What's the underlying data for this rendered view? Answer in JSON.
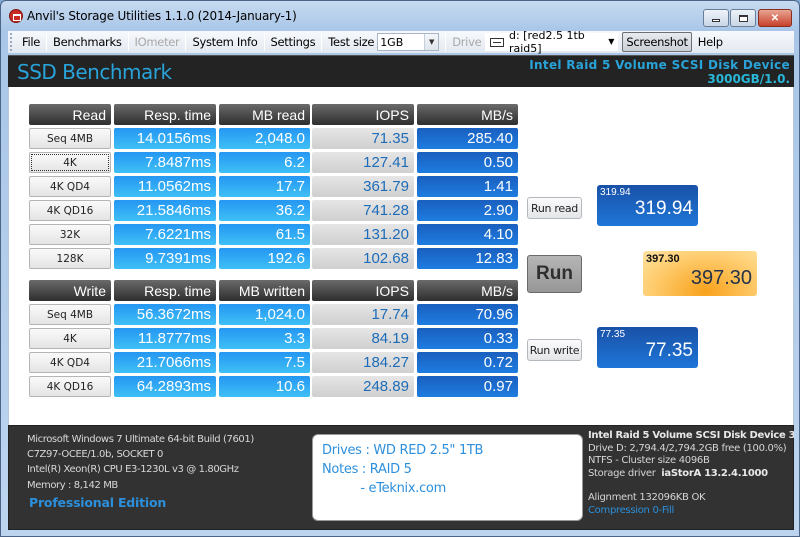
{
  "window": {
    "title": "Anvil's Storage Utilities 1.1.0 (2014-January-1)",
    "controls": [
      "minimize",
      "maximize",
      "close"
    ]
  },
  "toolbar": {
    "items": [
      "File",
      "Benchmarks",
      "IOmeter",
      "System Info",
      "Settings"
    ],
    "test_size_label": "Test size",
    "test_size_value": "1GB",
    "drive_label": "Drive",
    "drive_value": "d: [red2.5 1tb raid5]",
    "screenshot_label": "Screenshot",
    "help_label": "Help"
  },
  "header": {
    "title": "SSD Benchmark",
    "device": "Intel Raid 5 Volume SCSI Disk Device",
    "size": "3000GB/1.0."
  },
  "read": {
    "headers": [
      "Read",
      "Resp. time",
      "MB read",
      "IOPS",
      "MB/s"
    ],
    "rows": [
      {
        "label": "Seq 4MB",
        "resp": "14.0156ms",
        "mb": "2,048.0",
        "iops": "71.35",
        "mbs": "285.40"
      },
      {
        "label": "4K",
        "resp": "7.8487ms",
        "mb": "6.2",
        "iops": "127.41",
        "mbs": "0.50"
      },
      {
        "label": "4K QD4",
        "resp": "11.0562ms",
        "mb": "17.7",
        "iops": "361.79",
        "mbs": "1.41"
      },
      {
        "label": "4K QD16",
        "resp": "21.5846ms",
        "mb": "36.2",
        "iops": "741.28",
        "mbs": "2.90"
      },
      {
        "label": "32K",
        "resp": "7.6221ms",
        "mb": "61.5",
        "iops": "131.20",
        "mbs": "4.10"
      },
      {
        "label": "128K",
        "resp": "9.7391ms",
        "mb": "192.6",
        "iops": "102.68",
        "mbs": "12.83"
      }
    ]
  },
  "write": {
    "headers": [
      "Write",
      "Resp. time",
      "MB written",
      "IOPS",
      "MB/s"
    ],
    "rows": [
      {
        "label": "Seq 4MB",
        "resp": "56.3672ms",
        "mb": "1,024.0",
        "iops": "17.74",
        "mbs": "70.96"
      },
      {
        "label": "4K",
        "resp": "11.8777ms",
        "mb": "3.3",
        "iops": "84.19",
        "mbs": "0.33"
      },
      {
        "label": "4K QD4",
        "resp": "21.7066ms",
        "mb": "7.5",
        "iops": "184.27",
        "mbs": "0.72"
      },
      {
        "label": "4K QD16",
        "resp": "64.2893ms",
        "mb": "10.6",
        "iops": "248.89",
        "mbs": "0.97"
      }
    ]
  },
  "actions": {
    "run_read": "Run read",
    "run": "Run",
    "run_write": "Run write"
  },
  "scores": {
    "read_small": "319.94",
    "read_big": "319.94",
    "total_small": "397.30",
    "total_big": "397.30",
    "write_small": "77.35",
    "write_big": "77.35"
  },
  "system": {
    "lines": [
      "Microsoft Windows 7 Ultimate  64-bit Build (7601)",
      "C7Z97-OCEE/1.0b, SOCKET 0",
      "Intel(R) Xeon(R) CPU E3-1230L v3 @ 1.80GHz",
      "Memory : 8,142 MB"
    ],
    "edition": "Professional Edition"
  },
  "notes": {
    "lines": [
      "Drives : WD RED 2.5\" 1TB",
      "Notes : RAID 5",
      "          - eTeknix.com"
    ]
  },
  "drive_info": {
    "name": "Intel Raid 5 Volume SCSI Disk Device 3",
    "free": "Drive D: 2,794.4/2,794.2GB free (100.0%)",
    "fs": "NTFS - Cluster size 4096B",
    "driver_label": "Storage driver",
    "driver_value": "iaStorA 13.2.4.1000",
    "alignment": "Alignment 132096KB OK",
    "compression": "Compression 0-Fill"
  }
}
